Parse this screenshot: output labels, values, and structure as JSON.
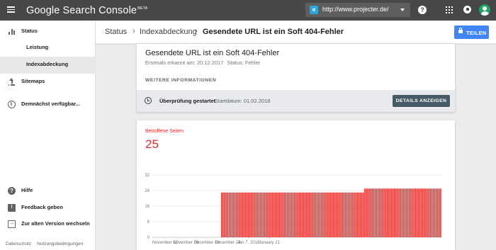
{
  "app": {
    "title": "Google Search Console",
    "badge": "BETA",
    "property_url": "http://www.projecter.de/",
    "property_favicon": "e",
    "help_glyph": "?"
  },
  "sidebar": {
    "items": [
      {
        "label": "Status",
        "icon": "bar-chart-icon"
      },
      {
        "label": "Leistung"
      },
      {
        "label": "Indexabdeckung",
        "selected": true
      },
      {
        "label": "Sitemaps",
        "icon": "upload-icon"
      },
      {
        "label": "Demnächst verfügbar...",
        "icon": "info-icon"
      }
    ],
    "bottom_items": [
      {
        "label": "Hilfe",
        "icon": "help-icon"
      },
      {
        "label": "Feedback geben",
        "icon": "feedback-icon"
      },
      {
        "label": "Zur alten Version wechseln",
        "icon": "exit-icon"
      }
    ],
    "footer": [
      "Datenschutz",
      "Nutzungsbedingungen"
    ]
  },
  "header": {
    "breadcrumb": [
      "Status",
      "Indexabdeckung",
      "Gesendete URL ist ein Soft 404-Fehler"
    ],
    "share_label": "TEILEN"
  },
  "issue": {
    "title": "Gesendete URL ist ein Soft 404-Fehler",
    "first_detected": "Erstmals erkannt am: 20.12.2017",
    "status": "Status: Fehler",
    "more_info": "WEITERE INFORMATIONEN",
    "validation_status": "Überprüfung gestartet",
    "validation_date": "Startdatum: 01.02.2018",
    "details_button": "DETAILS ANZEIGEN"
  },
  "chart_data": {
    "type": "bar",
    "metric_label": "Betroffene Seiten",
    "metric_value": "25",
    "ylim": [
      0,
      32
    ],
    "yticks": [
      0,
      8,
      16,
      24,
      32
    ],
    "xtick_labels": [
      "November 12",
      "November 26",
      "December 10",
      "December 24",
      "Jan 7, 2018",
      "January 21"
    ],
    "start_date": "2017-11-04",
    "values": [
      0,
      0,
      0,
      0,
      0,
      0,
      0,
      0,
      0,
      0,
      0,
      0,
      0,
      0,
      0,
      0,
      0,
      0,
      0,
      0,
      0,
      0,
      0,
      0,
      0,
      0,
      0,
      0,
      0,
      0,
      0,
      0,
      0,
      0,
      0,
      0,
      0,
      0,
      0,
      0,
      0,
      0,
      0,
      0,
      0,
      0,
      23,
      23,
      23,
      23,
      23,
      23,
      23,
      23,
      23,
      23,
      23,
      23,
      23,
      23,
      23,
      23,
      23,
      23,
      23,
      23,
      23,
      23,
      23,
      23,
      23,
      23,
      23,
      23,
      23,
      23,
      23,
      23,
      23,
      23,
      23,
      23,
      23,
      23,
      23,
      23,
      23,
      23,
      23,
      23,
      23,
      23,
      23,
      23,
      23,
      23,
      23,
      23,
      23,
      23,
      23,
      23,
      23,
      23,
      23,
      23,
      23,
      23,
      23,
      23,
      23,
      23,
      23,
      23,
      23,
      23,
      23,
      23,
      23,
      23,
      23,
      23,
      23,
      23,
      23,
      23,
      23,
      23,
      23,
      23,
      23,
      23,
      23,
      23,
      23,
      23,
      23,
      23,
      23,
      23,
      23,
      23,
      25,
      25,
      25,
      25,
      25,
      25,
      25,
      25,
      25,
      25,
      25,
      25,
      25,
      25,
      25,
      25,
      25,
      25,
      25,
      25,
      25,
      25,
      25,
      25,
      25,
      25,
      25,
      25,
      25,
      25,
      25,
      25,
      25,
      25,
      25,
      25,
      25,
      25,
      25,
      25,
      25,
      25,
      25,
      25,
      25,
      25,
      25,
      25,
      25,
      25,
      25,
      25
    ],
    "bar_color": "#e53935",
    "grid": true
  }
}
